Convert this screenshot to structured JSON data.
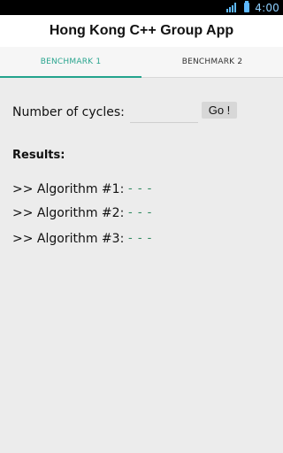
{
  "status_bar": {
    "time": "4:00",
    "icons": [
      "signal-icon",
      "battery-icon"
    ],
    "accent_color": "#5eb9ff"
  },
  "app_bar": {
    "title": "Hong Kong C++ Group App"
  },
  "tabs": [
    {
      "label": "BENCHMARK 1",
      "active": true
    },
    {
      "label": "BENCHMARK 2",
      "active": false
    }
  ],
  "colors": {
    "active_tab": "#2aa58f",
    "background": "#ececec",
    "result_value": "#2f8a5f"
  },
  "form": {
    "cycles_label": "Number of cycles:",
    "cycles_value": "",
    "go_label": "Go !"
  },
  "results": {
    "heading": "Results:",
    "rows": [
      {
        "name": ">> Algorithm #1:",
        "value": "- - -"
      },
      {
        "name": ">> Algorithm #2:",
        "value": "- - -"
      },
      {
        "name": ">> Algorithm #3:",
        "value": "- - -"
      }
    ]
  }
}
